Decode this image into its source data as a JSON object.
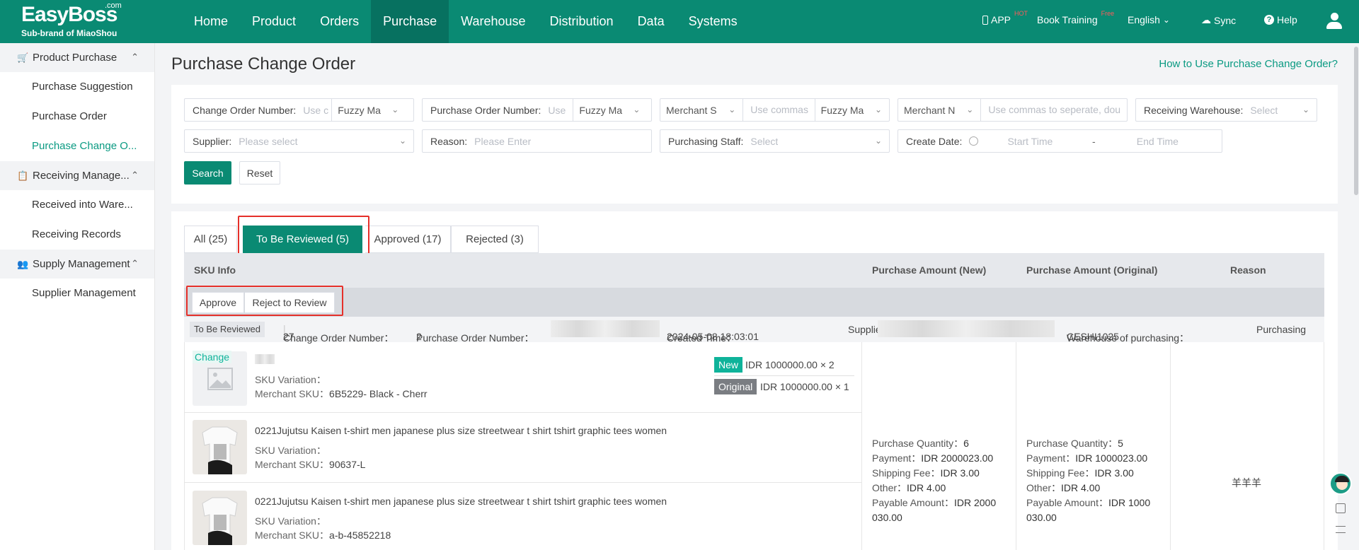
{
  "brand": {
    "name": "EasyBoss",
    "com": ".com",
    "sub": "Sub-brand of MiaoShou"
  },
  "nav": [
    "Home",
    "Product",
    "Orders",
    "Purchase",
    "Warehouse",
    "Distribution",
    "Data",
    "Systems"
  ],
  "nav_active": "Purchase",
  "top_right": {
    "app": "APP",
    "app_sup": "HOT",
    "training": "Book Training",
    "training_sup": "Free",
    "language": "English",
    "sync": "Sync",
    "help": "Help"
  },
  "sidebar": {
    "groups": [
      {
        "label": "Product Purchase",
        "items": [
          "Purchase Suggestion",
          "Purchase Order",
          "Purchase Change O..."
        ]
      },
      {
        "label": "Receiving Manage...",
        "items": [
          "Received into Ware...",
          "Receiving Records"
        ]
      },
      {
        "label": "Supply Management",
        "items": [
          "Supplier Management"
        ]
      }
    ],
    "active_item": "Purchase Change O..."
  },
  "page": {
    "title": "Purchase Change Order",
    "help_link": "How to Use Purchase Change Order?"
  },
  "filters": {
    "change_order_number": {
      "label": "Change Order Number:",
      "placeholder": "Use c",
      "match": "Fuzzy Ma"
    },
    "purchase_order_number": {
      "label": "Purchase Order Number:",
      "placeholder": "Use",
      "match": "Fuzzy Ma"
    },
    "merchant_s": {
      "label": "Merchant S",
      "placeholder": "Use commas",
      "match": "Fuzzy Ma"
    },
    "merchant_n": {
      "label": "Merchant N",
      "placeholder": "Use commas to seperate, dou"
    },
    "receiving_warehouse": {
      "label": "Receiving Warehouse:",
      "placeholder": "Select"
    },
    "supplier": {
      "label": "Supplier:",
      "placeholder": "Please select"
    },
    "reason": {
      "label": "Reason:",
      "placeholder": "Please Enter"
    },
    "purchasing_staff": {
      "label": "Purchasing Staff:",
      "placeholder": "Select"
    },
    "create_date": {
      "label": "Create Date:",
      "start": "Start Time",
      "sep": "-",
      "end": "End Time"
    },
    "search_label": "Search",
    "reset_label": "Reset"
  },
  "tabs": [
    {
      "label": "All (25)"
    },
    {
      "label": "To Be Reviewed (5)"
    },
    {
      "label": "Approved (17)"
    },
    {
      "label": "Rejected (3)"
    }
  ],
  "active_tab": "To Be Reviewed (5)",
  "table": {
    "headers": [
      "SKU Info",
      "Purchase Amount (New)",
      "Purchase Amount (Original)",
      "Reason"
    ],
    "bulk": {
      "approve": "Approve",
      "reject": "Reject to Review"
    }
  },
  "order": {
    "status": "To Be Reviewed",
    "change_no_label": "Change Order Number：",
    "change_no": "27",
    "po_label": "Purchase Order Number：",
    "po_prefix": "2",
    "created_label": "Created Time：",
    "created": "2024-05-08 18:03:01",
    "supplier_label": "Supplie",
    "warehouse_label": "Warehouse of purchasing：",
    "warehouse": "CESHI1025",
    "purchasing": "Purchasing",
    "change_tag": "Change",
    "items": [
      {
        "title": "",
        "variation": "SKU Variation：",
        "merchant_sku_label": "Merchant SKU：",
        "merchant_sku": "6B5229- Black - Cherr",
        "new_tag": "New",
        "new_price": "IDR 1000000.00 × 2",
        "orig_tag": "Original",
        "orig_price": "IDR 1000000.00 × 1"
      },
      {
        "title": "0221Jujutsu Kaisen t-shirt men japanese plus size streetwear t shirt tshirt graphic tees women",
        "variation": "SKU Variation：",
        "merchant_sku_label": "Merchant SKU：",
        "merchant_sku": "90637-L"
      },
      {
        "title": "0221Jujutsu Kaisen t-shirt men japanese plus size streetwear t shirt tshirt graphic tees women",
        "variation": "SKU Variation：",
        "merchant_sku_label": "Merchant SKU：",
        "merchant_sku": "a-b-45852218"
      }
    ],
    "amount_new": {
      "qty_label": "Purchase Quantity：",
      "qty": "6",
      "pay_label": "Payment：",
      "pay": "IDR 2000023.00",
      "ship_label": "Shipping Fee：",
      "ship": "IDR 3.00",
      "other_label": "Other：",
      "other": "IDR 4.00",
      "payable_label": "Payable Amount：",
      "payable_a": "IDR 2000",
      "payable_b": "030.00"
    },
    "amount_orig": {
      "qty_label": "Purchase Quantity：",
      "qty": "5",
      "pay_label": "Payment：",
      "pay": "IDR 1000023.00",
      "ship_label": "Shipping Fee：",
      "ship": "IDR 3.00",
      "other_label": "Other：",
      "other": "IDR 4.00",
      "payable_label": "Payable Amount：",
      "payable_a": "IDR 1000",
      "payable_b": "030.00"
    },
    "reason": "羊羊羊"
  },
  "colors": {
    "brand": "#0a8a73",
    "accent": "#0a9a82",
    "highlight": "#e5302a",
    "new_tag": "#0fb39a",
    "orig_tag": "#7a7d82"
  }
}
